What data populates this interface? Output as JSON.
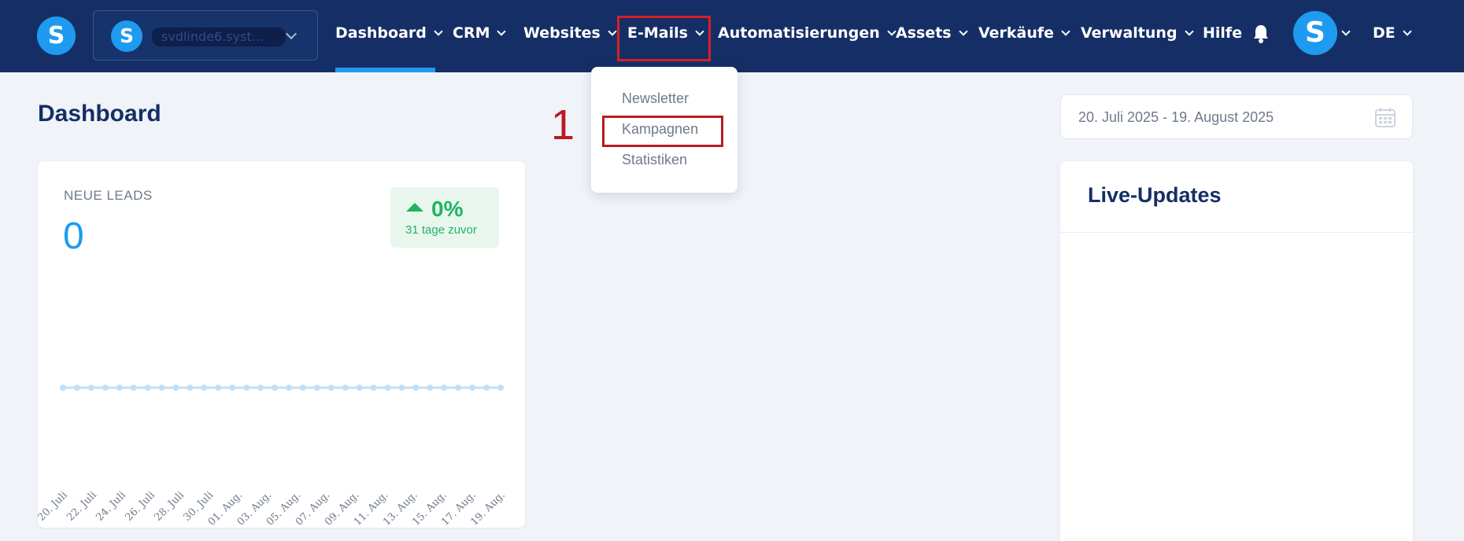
{
  "app": {
    "logo_letter": "S",
    "account_name": "svdlinde6.syst...",
    "account_logo_letter": "S",
    "avatar_letter": "S"
  },
  "nav": {
    "items": [
      {
        "label": "Dashboard",
        "has_chevron": true
      },
      {
        "label": "CRM",
        "has_chevron": true
      },
      {
        "label": "Websites",
        "has_chevron": true
      },
      {
        "label": "E-Mails",
        "has_chevron": true
      },
      {
        "label": "Automatisierungen",
        "has_chevron": true
      },
      {
        "label": "Assets",
        "has_chevron": true
      },
      {
        "label": "Verkäufe",
        "has_chevron": true
      },
      {
        "label": "Verwaltung",
        "has_chevron": true
      },
      {
        "label": "Hilfe",
        "has_chevron": false
      }
    ],
    "language": "DE",
    "icons": {
      "bell": "bell-icon"
    }
  },
  "dropdown": {
    "items": [
      "Newsletter",
      "Kampagnen",
      "Statistiken"
    ]
  },
  "annotation": {
    "step_number": "1"
  },
  "page": {
    "title": "Dashboard",
    "date_range": "20. Juli 2025 - 19. August 2025"
  },
  "leads_card": {
    "label": "NEUE LEADS",
    "value": "0",
    "trend_percent": "0%",
    "trend_sub": "31 tage zuvor"
  },
  "chart_data": {
    "type": "line",
    "title": "",
    "xlabel": "",
    "ylabel": "",
    "x_ticks": [
      "20. Juli",
      "22. Juli",
      "24. Juli",
      "26. Juli",
      "28. Juli",
      "30. Juli",
      "01. Aug.",
      "03. Aug.",
      "05. Aug.",
      "07. Aug.",
      "09. Aug.",
      "11. Aug.",
      "13. Aug.",
      "15. Aug.",
      "17. Aug.",
      "19. Aug."
    ],
    "series": [
      {
        "values": [
          0,
          0,
          0,
          0,
          0,
          0,
          0,
          0,
          0,
          0,
          0,
          0,
          0,
          0,
          0,
          0,
          0,
          0,
          0,
          0,
          0,
          0,
          0,
          0,
          0,
          0,
          0,
          0,
          0,
          0,
          0,
          0
        ]
      }
    ],
    "color": "#bfe0fb",
    "grid": false
  },
  "live_card": {
    "title": "Live-Updates"
  }
}
